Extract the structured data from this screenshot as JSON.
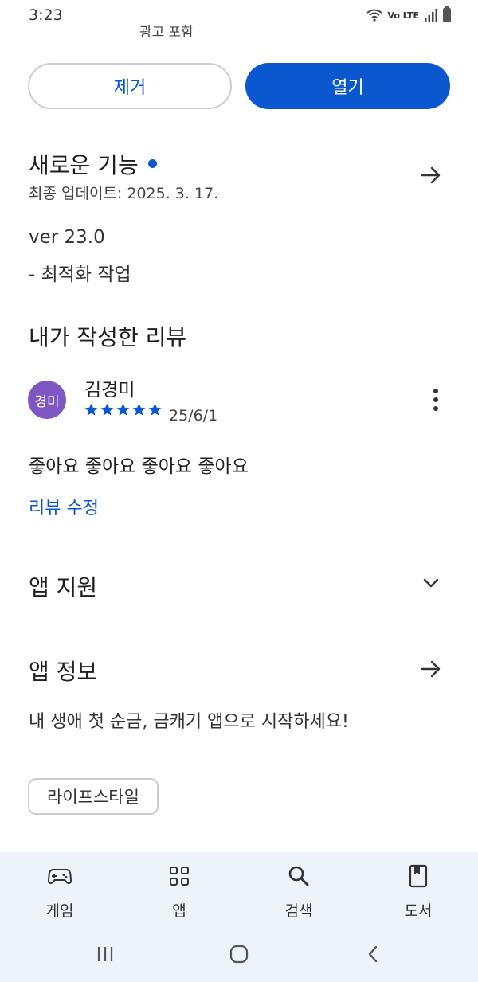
{
  "status_bar": {
    "time": "3:23",
    "network_label": "Vo LTE"
  },
  "ad_note": "광고 포함",
  "actions": {
    "remove_label": "제거",
    "open_label": "열기"
  },
  "whats_new": {
    "title": "새로운 기능",
    "last_updated": "최종 업데이트: 2025. 3. 17.",
    "version": "ver 23.0",
    "notes": "- 최적화 작업"
  },
  "my_review": {
    "title": "내가 작성한 리뷰",
    "avatar_text": "경미",
    "reviewer_name": "김경미",
    "rating": 5,
    "date": "25/6/1",
    "text": "좋아요 좋아요 좋아요 좋아요",
    "edit_label": "리뷰 수정"
  },
  "app_support": {
    "title": "앱 지원"
  },
  "app_info": {
    "title": "앱 정보",
    "description": "내 생애 첫 순금, 금캐기 앱으로 시작하세요!",
    "category_chip": "라이프스타일"
  },
  "bottom_nav": {
    "items": [
      {
        "label": "게임",
        "icon": "gamepad-icon"
      },
      {
        "label": "앱",
        "icon": "apps-grid-icon"
      },
      {
        "label": "검색",
        "icon": "search-icon"
      },
      {
        "label": "도서",
        "icon": "book-icon"
      }
    ]
  },
  "colors": {
    "accent": "#0b57d0",
    "avatar": "#7e57c2",
    "nav_background": "#eef2f9"
  }
}
